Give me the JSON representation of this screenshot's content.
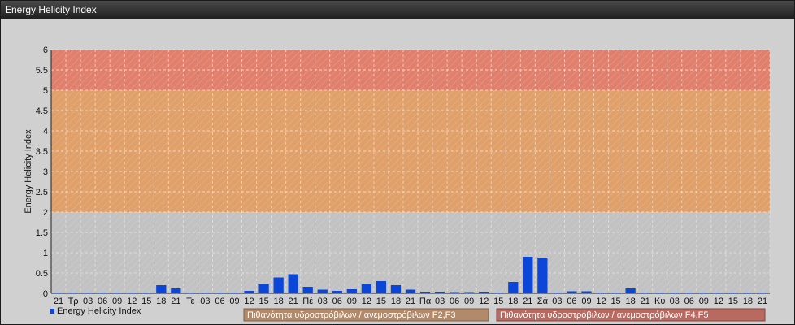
{
  "window": {
    "title": "Energy Helicity Index"
  },
  "colors": {
    "bar": "#0b46d8",
    "band_high": "#e0806c",
    "band_mid": "#e0a06a",
    "band_low": "#c2c2c2",
    "grid": "#e6e6e6"
  },
  "notes": {
    "band_mid_label": "Πιθανότητα υδροστρόβιλων / ανεμοστρόβιλων F2,F3",
    "band_high_label": "Πιθανότητα υδροστρόβιλων / ανεμοστρόβιλων F4,F5"
  },
  "chart_data": {
    "type": "bar",
    "ylabel": "Energy Helicity Index",
    "ylim": [
      0,
      6
    ],
    "yticks": [
      "0",
      "0.5",
      "1",
      "1.5",
      "2",
      "2.5",
      "3",
      "3.5",
      "4",
      "4.5",
      "5",
      "5.5",
      "6"
    ],
    "bands": [
      {
        "from": 0,
        "to": 2,
        "color": "#c2c2c2"
      },
      {
        "from": 2,
        "to": 5,
        "color": "#e0a06a"
      },
      {
        "from": 5,
        "to": 6,
        "color": "#e0806c"
      }
    ],
    "categories": [
      "21",
      "Τρ",
      "03",
      "06",
      "09",
      "12",
      "15",
      "18",
      "21",
      "Τε",
      "03",
      "06",
      "09",
      "12",
      "15",
      "18",
      "21",
      "Πέ",
      "03",
      "06",
      "09",
      "12",
      "15",
      "18",
      "21",
      "Πα",
      "03",
      "06",
      "09",
      "12",
      "15",
      "18",
      "21",
      "Σά",
      "03",
      "06",
      "09",
      "12",
      "15",
      "18",
      "21",
      "Κυ",
      "03",
      "06",
      "09",
      "12",
      "15",
      "18",
      "21"
    ],
    "series": [
      {
        "name": "Energy Helicity Index",
        "values": [
          0.01,
          0.01,
          0.01,
          0.01,
          0.01,
          0.02,
          0.01,
          0.2,
          0.12,
          0.01,
          0.02,
          0.02,
          0.01,
          0.06,
          0.22,
          0.39,
          0.47,
          0.16,
          0.09,
          0.06,
          0.1,
          0.22,
          0.3,
          0.2,
          0.09,
          0.04,
          0.04,
          0.03,
          0.03,
          0.04,
          0.01,
          0.28,
          0.9,
          0.88,
          0.01,
          0.05,
          0.05,
          0.01,
          0.01,
          0.12,
          0.01,
          0.01,
          0.01,
          0.01,
          0.01,
          0.01,
          0.01,
          0.01,
          0.01
        ]
      }
    ],
    "grid": true,
    "legend": "bottom-left"
  }
}
